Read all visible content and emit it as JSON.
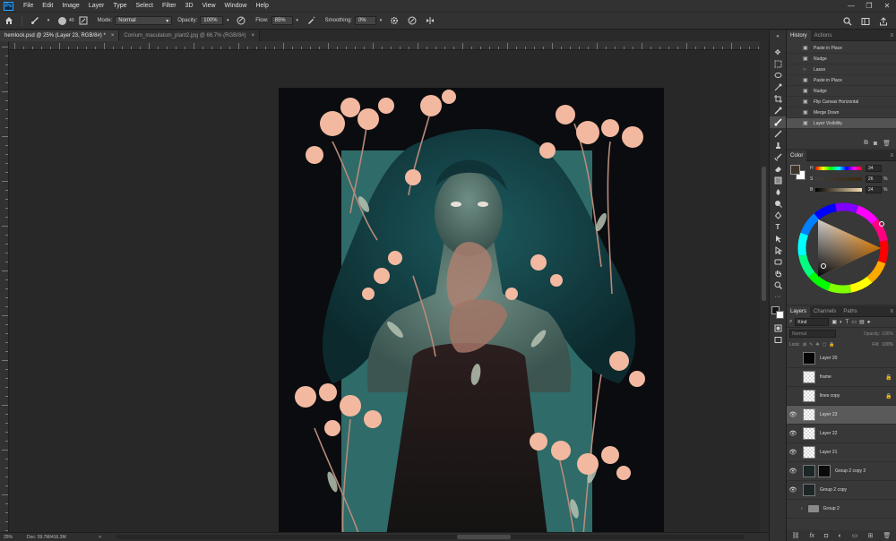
{
  "app": {
    "logo": "Ps"
  },
  "menu": [
    "File",
    "Edit",
    "Image",
    "Layer",
    "Type",
    "Select",
    "Filter",
    "3D",
    "View",
    "Window",
    "Help"
  ],
  "window_controls": {
    "minimize": "—",
    "restore": "❐",
    "close": "✕"
  },
  "options": {
    "brush_size": "40",
    "mode_label": "Mode:",
    "mode_value": "Normal",
    "opacity_label": "Opacity:",
    "opacity_value": "100%",
    "flow_label": "Flow:",
    "flow_value": "85%",
    "smoothing_label": "Smoothing:",
    "smoothing_value": "0%"
  },
  "tabs": [
    {
      "label": "hemlock.psd @ 25% (Layer 23, RGB/8#) *",
      "close": "×"
    },
    {
      "label": "Conium_maculatum_plant2.jpg @ 66.7% (RGB/8#)",
      "close": "×"
    }
  ],
  "status": {
    "zoom": "25%",
    "doc": "Doc: 39.7M/416.3M",
    "arrow": ">"
  },
  "history": {
    "tabs": [
      "History",
      "Actions"
    ],
    "items": [
      {
        "label": "Paste in Place"
      },
      {
        "label": "Nudge"
      },
      {
        "label": "Lasso"
      },
      {
        "label": "Paste in Place"
      },
      {
        "label": "Nudge"
      },
      {
        "label": "Flip Canvas Horizontal"
      },
      {
        "label": "Merge Down"
      },
      {
        "label": "Layer Visibility"
      }
    ]
  },
  "color": {
    "tab": "Color",
    "sliders": [
      {
        "label": "H",
        "value": "34",
        "pct": ""
      },
      {
        "label": "S",
        "value": "26",
        "pct": "%"
      },
      {
        "label": "B",
        "value": "24",
        "pct": "%"
      }
    ]
  },
  "layers": {
    "tabs": [
      "Layers",
      "Channels",
      "Paths"
    ],
    "kind": "Kind",
    "blend": "Normal",
    "opacity_label": "Opacity:",
    "opacity_value": "100%",
    "lock_label": "Lock:",
    "fill_label": "Fill:",
    "fill_value": "100%",
    "rows": [
      {
        "name": "Layer 20",
        "visible": false,
        "thumb": "black",
        "locked": false
      },
      {
        "name": "frame",
        "visible": false,
        "thumb": "trans",
        "locked": true
      },
      {
        "name": "lines copy",
        "visible": false,
        "thumb": "trans",
        "locked": true
      },
      {
        "name": "Layer 23",
        "visible": true,
        "thumb": "trans",
        "locked": false,
        "selected": true
      },
      {
        "name": "Layer 22",
        "visible": true,
        "thumb": "trans",
        "locked": false
      },
      {
        "name": "Layer 21",
        "visible": true,
        "thumb": "trans",
        "locked": false
      },
      {
        "name": "Group 2 copy 2",
        "visible": true,
        "thumb": "dark",
        "locked": false,
        "mask": true
      },
      {
        "name": "Group 2 copy",
        "visible": true,
        "thumb": "dark",
        "locked": false
      },
      {
        "name": "Group 2",
        "visible": false,
        "thumb": "folder",
        "locked": false
      }
    ]
  },
  "colors": {
    "accent": "#31a8ff",
    "panel": "#383838",
    "artwork_bg": "#0b0c0f",
    "teal": "#2f6b69",
    "flower": "#f2b9a0",
    "hair": "#123c40"
  },
  "icons": {
    "home": "home-icon",
    "brush": "brush-icon",
    "settings": "gear-icon",
    "search": "search-icon"
  }
}
